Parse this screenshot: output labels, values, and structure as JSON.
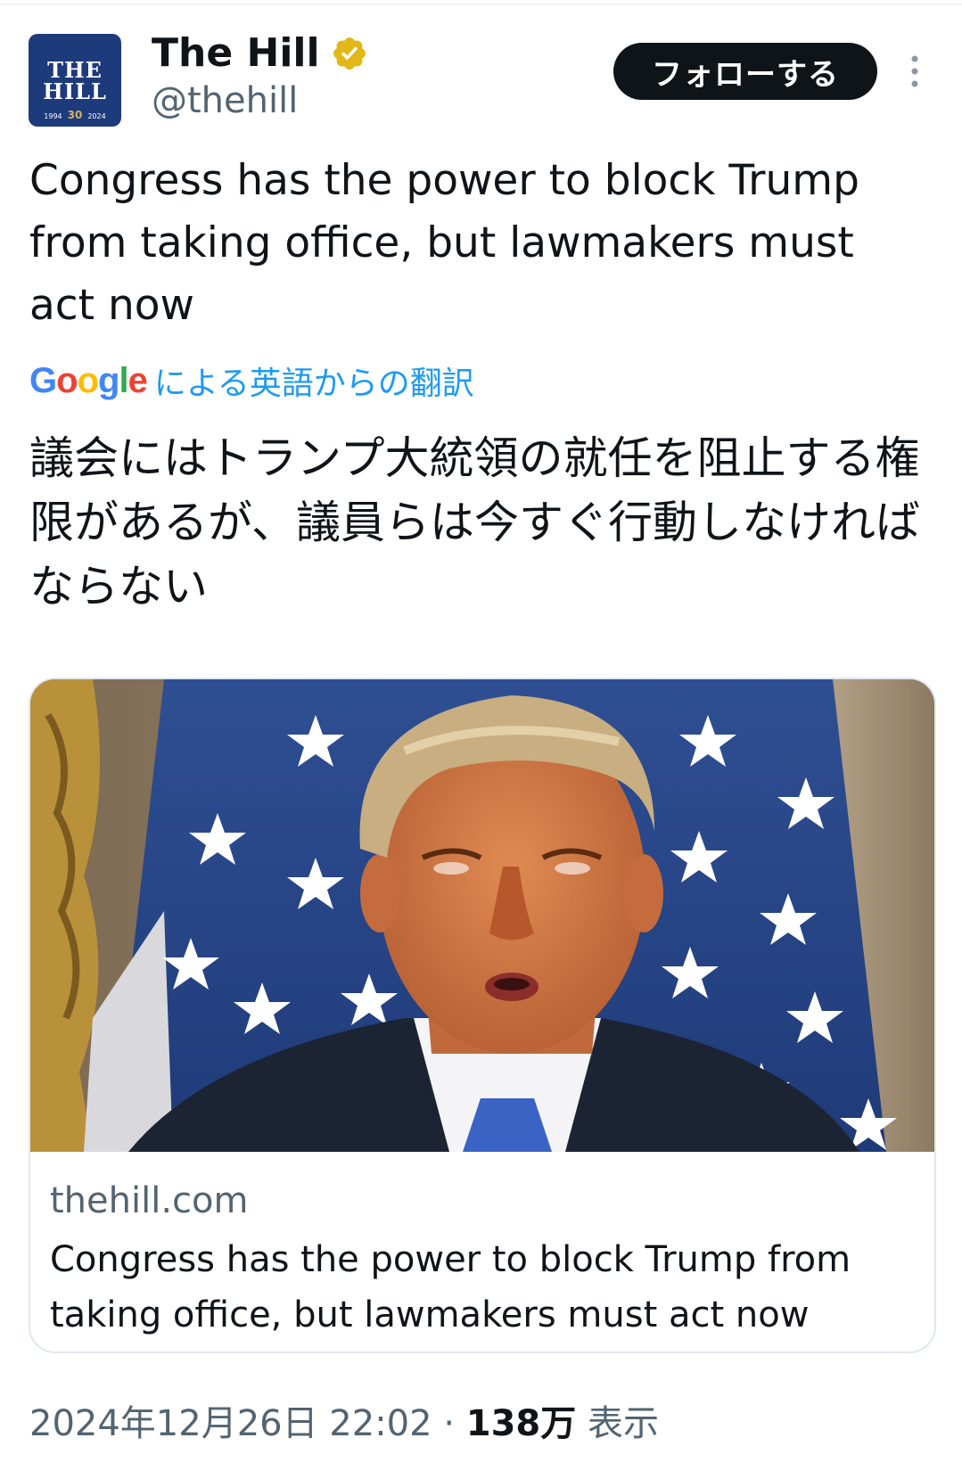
{
  "account": {
    "display_name": "The Hill",
    "handle": "@thehill",
    "avatar": {
      "line1": "THE",
      "line2": "HILL",
      "year_start": "1994",
      "anniversary": "30",
      "year_end": "2024"
    },
    "verified_icon": "verified-badge-gold"
  },
  "actions": {
    "follow_label": "フォローする",
    "more_icon": "more-vertical-icon"
  },
  "tweet": {
    "text_en": "Congress has the power to block Trump from taking office, but lawmakers must act now",
    "translation_brand": [
      "G",
      "o",
      "o",
      "g",
      "l",
      "e"
    ],
    "translation_label": "による英語からの翻訳",
    "text_ja": "議会にはトランプ大統領の就任を阻止する権限があるが、議員らは今すぐ行動しなければならない"
  },
  "card": {
    "domain": "thehill.com",
    "title": "Congress has the power to block Trump from taking office, but lawmakers must act now"
  },
  "meta": {
    "timestamp": "2024年12月26日 22:02",
    "separator": "·",
    "views_count": "138万",
    "views_label": "表示"
  },
  "colors": {
    "text": "#0f1419",
    "secondary": "#536471",
    "link": "#1d9bf0",
    "verified": "#e2b719",
    "avatar_bg": "#1d3a7a"
  }
}
